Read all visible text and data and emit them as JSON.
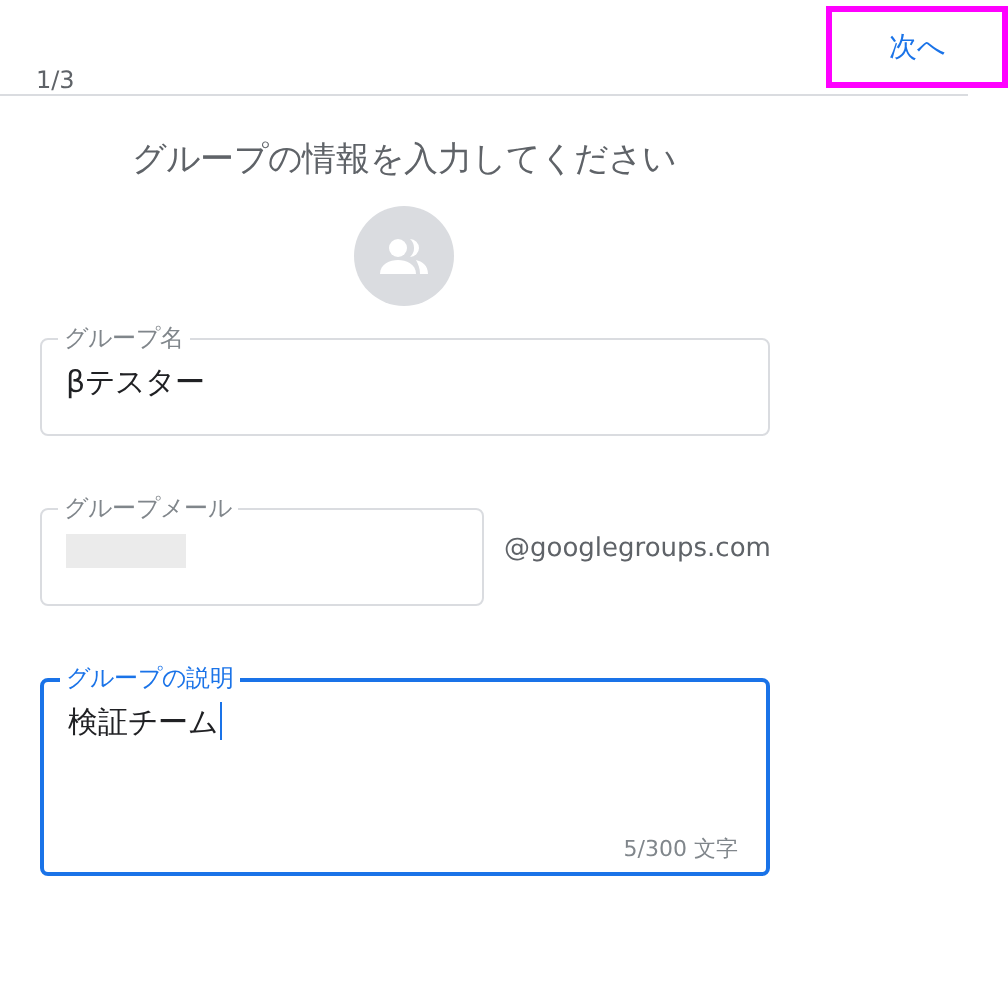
{
  "header": {
    "step": "1/3",
    "next_button": {
      "label": "次へ",
      "highlighted": true
    }
  },
  "title": "グループの情報を入力してください",
  "fields": [
    {
      "kind": "text",
      "label": "グループ名",
      "value": "βテスター",
      "focused": false
    },
    {
      "kind": "email",
      "label": "グループメール",
      "redacted": true,
      "suffix": "@googlegroups.com",
      "focused": false
    },
    {
      "kind": "textarea",
      "label": "グループの説明",
      "value": "検証チーム",
      "focused": true,
      "counter": "5/300 文字"
    }
  ]
}
